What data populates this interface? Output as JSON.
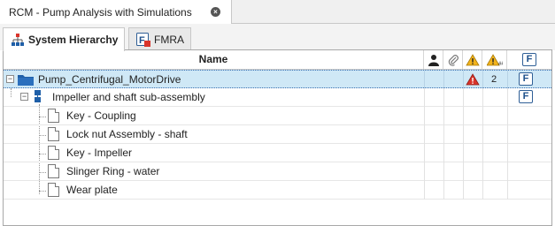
{
  "doc_tab": {
    "title": "RCM - Pump Analysis with Simulations",
    "close_glyph": "×"
  },
  "view_tabs": [
    {
      "label": "System Hierarchy",
      "icon": "hierarchy-icon"
    },
    {
      "label": "FMRA",
      "icon": "fmra-icon"
    }
  ],
  "grid": {
    "columns": {
      "name": "Name",
      "user": "user-icon",
      "attachment": "paperclip-icon",
      "warning": "warning-icon",
      "warning_count": "warning-count-icon",
      "f": "F"
    },
    "rows": [
      {
        "label": "Pump_Centrifugal_MotorDrive",
        "expander": "−",
        "selected": true,
        "warning": true,
        "count": "2",
        "f": "F"
      },
      {
        "label": "Impeller and shaft sub-assembly",
        "expander": "−",
        "f": "F"
      },
      {
        "label": "Key - Coupling"
      },
      {
        "label": "Lock nut Assembly - shaft"
      },
      {
        "label": "Key - Impeller"
      },
      {
        "label": "Slinger Ring - water"
      },
      {
        "label": "Wear plate"
      }
    ]
  },
  "colors": {
    "selection": "#cfe8f6",
    "folder_blue": "#1f5fa8",
    "warning_red": "#d9342b",
    "warning_yellow": "#f2b31b"
  }
}
